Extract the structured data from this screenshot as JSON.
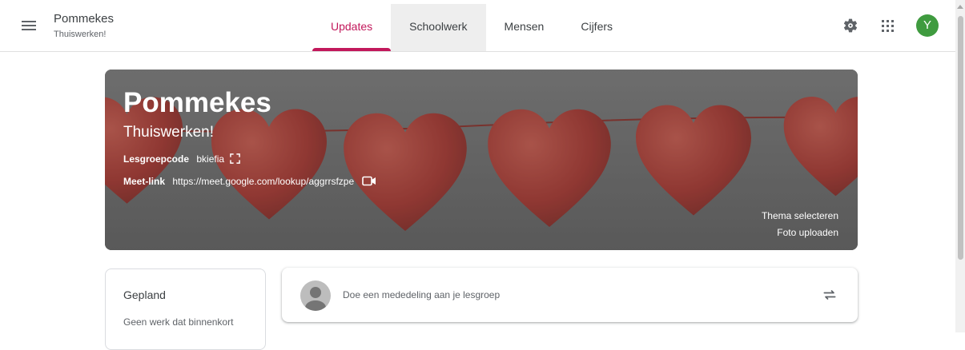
{
  "header": {
    "menu_icon": "menu-icon",
    "course_title": "Pommekes",
    "course_subtitle": "Thuiswerken!",
    "tabs": [
      {
        "label": "Updates",
        "active": true
      },
      {
        "label": "Schoolwerk",
        "active": false
      },
      {
        "label": "Mensen",
        "active": false
      },
      {
        "label": "Cijfers",
        "active": false
      }
    ],
    "settings_icon": "gear-icon",
    "apps_icon": "apps-grid-icon",
    "avatar_letter": "Y"
  },
  "banner": {
    "title": "Pommekes",
    "subtitle": "Thuiswerken!",
    "code_label": "Lesgroepcode",
    "code_value": "bkiefia",
    "meet_label": "Meet-link",
    "meet_url": "https://meet.google.com/lookup/aggrrsfzpe",
    "select_theme": "Thema selecteren",
    "upload_photo": "Foto uploaden"
  },
  "upcoming": {
    "title": "Gepland",
    "text": "Geen werk dat binnenkort"
  },
  "stream": {
    "announce_placeholder": "Doe een mededeling aan je lesgroep"
  },
  "colors": {
    "accent": "#c2185b",
    "avatar": "#3f9b3f",
    "banner_bg": "#6d6d6d",
    "heart": "#b23a32"
  }
}
